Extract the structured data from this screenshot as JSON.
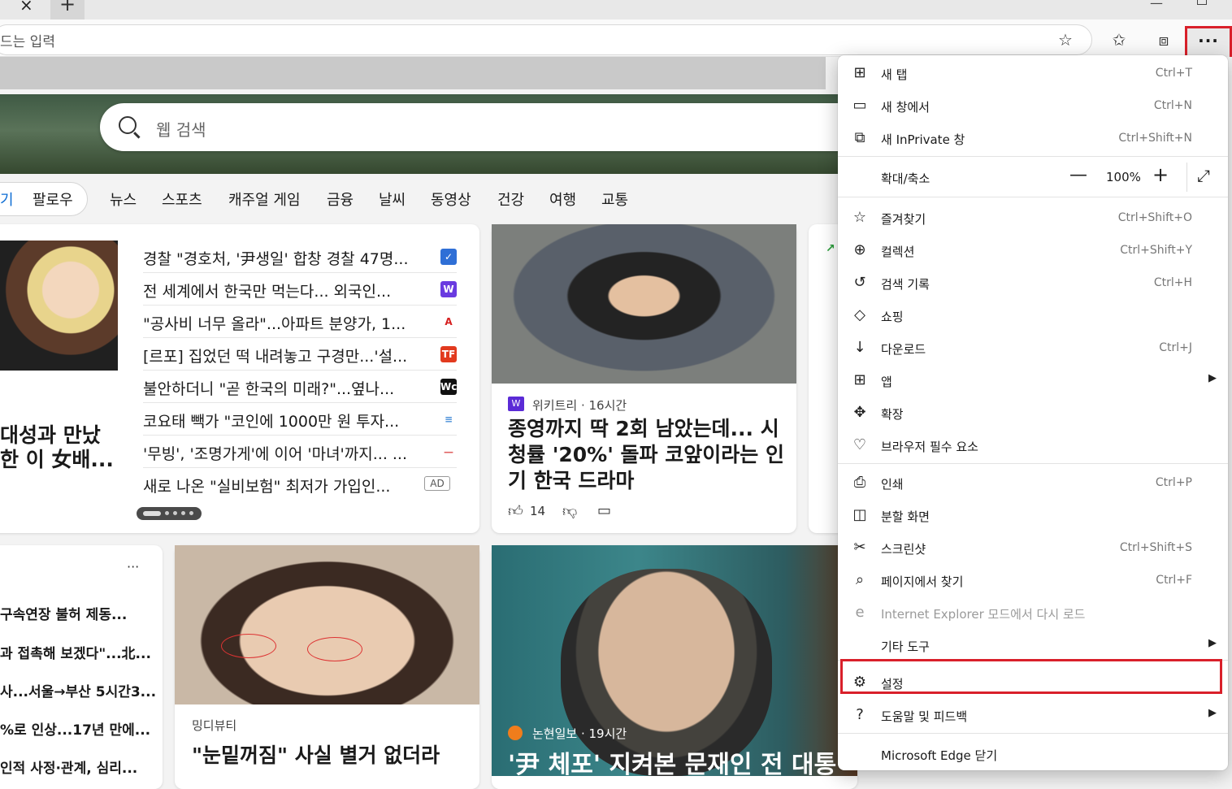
{
  "toolbar": {
    "address_text": "드는 입력",
    "more_label": "···",
    "tab_close": "×",
    "tab_new": "+"
  },
  "page": {
    "search_placeholder": "웹 검색",
    "nav": {
      "first": "기",
      "follow": "팔로우",
      "items": [
        "뉴스",
        "스포츠",
        "캐주얼 게임",
        "금융",
        "날씨",
        "동영상",
        "건강",
        "여행",
        "교통"
      ]
    },
    "card_a": {
      "headline_lines": [
        "대성과 만났",
        "한 이 女배..."
      ],
      "news": [
        {
          "text": "경찰 \"경호처, '尹생일' 합창 경찰 47명...",
          "source_icon": "✓",
          "color": "#2f6fd6"
        },
        {
          "text": "전 세계에서 한국만 먹는다... 외국인...",
          "source_icon": "W",
          "color": "#6a3be0"
        },
        {
          "text": "\"공사비 너무 올라\"...아파트 분양가, 1...",
          "source_icon": "A",
          "color": "#d62020"
        },
        {
          "text": "[르포] 집었던 떡 내려놓고 구경만...'설...",
          "source_icon": "TF",
          "color": "#e23a1e"
        },
        {
          "text": "불안하더니 \"곧 한국의 미래?\"...옆나...",
          "source_icon": "Wc",
          "color": "#111111"
        },
        {
          "text": "코요태 빽가 \"코인에 1000만 원 투자...",
          "source_icon": "≡",
          "color": "#4a8fd8"
        },
        {
          "text": "'무빙', '조명가게'에 이어 '마녀'까지... ...",
          "source_icon": "—",
          "color": "#e06060"
        },
        {
          "text": "새로 나온 \"실비보험\" 최저가 가입인...",
          "source_icon": "",
          "color": "#ffffff"
        }
      ],
      "ad_label": "AD"
    },
    "card_b": {
      "source": "위키트리 · 16시간",
      "title": "종영까지 딱 2회 남았는데... 시청률 '20%' 돌파 코앞이라는 인기 한국 드라마",
      "likes": "14"
    },
    "card_d": {
      "more": "···",
      "items": [
        "구속연장 불허 제동...",
        "과 접촉해 보겠다\"...北...",
        "사...서울→부산 5시간3...",
        "%로 인상...17년 만에...",
        "인적 사정·관계, 심리..."
      ]
    },
    "card_e": {
      "source": "밍디뷰티",
      "title": "\"눈밑꺼짐\" 사실 별거 없더라"
    },
    "card_f": {
      "source": "논현일보 · 19시간",
      "title": "'尹 체포' 지켜본 문재인 전 대통"
    }
  },
  "menu": {
    "items_top": [
      {
        "label": "새 탭",
        "shortcut": "Ctrl+T",
        "icon": "new-tab-icon",
        "glyph": "⊞"
      },
      {
        "label": "새 창에서",
        "shortcut": "Ctrl+N",
        "icon": "new-window-icon",
        "glyph": "▭"
      },
      {
        "label": "새 InPrivate 창",
        "shortcut": "Ctrl+Shift+N",
        "icon": "inprivate-icon",
        "glyph": "⧉"
      }
    ],
    "zoom": {
      "label": "확대/축소",
      "minus": "—",
      "value": "100%",
      "plus": "+",
      "fullscreen": "⤢"
    },
    "items_mid": [
      {
        "label": "즐겨찾기",
        "shortcut": "Ctrl+Shift+O",
        "icon": "favorites-icon",
        "glyph": "☆"
      },
      {
        "label": "컬렉션",
        "shortcut": "Ctrl+Shift+Y",
        "icon": "collections-icon",
        "glyph": "⊕"
      },
      {
        "label": "검색 기록",
        "shortcut": "Ctrl+H",
        "icon": "history-icon",
        "glyph": "↺"
      },
      {
        "label": "쇼핑",
        "shortcut": "",
        "icon": "shopping-tag-icon",
        "glyph": "◇"
      },
      {
        "label": "다운로드",
        "shortcut": "Ctrl+J",
        "icon": "download-icon",
        "glyph": "↓"
      },
      {
        "label": "앱",
        "shortcut": "",
        "icon": "apps-icon",
        "glyph": "⊞",
        "arrow": "▶"
      },
      {
        "label": "확장",
        "shortcut": "",
        "icon": "extensions-icon",
        "glyph": "✥"
      },
      {
        "label": "브라우저 필수 요소",
        "shortcut": "",
        "icon": "heart-pulse-icon",
        "glyph": "♡"
      }
    ],
    "items_tools": [
      {
        "label": "인쇄",
        "shortcut": "Ctrl+P",
        "icon": "print-icon",
        "glyph": "⎙"
      },
      {
        "label": "분할 화면",
        "shortcut": "",
        "icon": "split-screen-icon",
        "glyph": "◫"
      },
      {
        "label": "스크린샷",
        "shortcut": "Ctrl+Shift+S",
        "icon": "screenshot-icon",
        "glyph": "✂"
      },
      {
        "label": "페이지에서 찾기",
        "shortcut": "Ctrl+F",
        "icon": "find-icon",
        "glyph": "⌕"
      },
      {
        "label": "Internet Explorer 모드에서 다시 로드",
        "shortcut": "",
        "icon": "ie-mode-icon",
        "glyph": "e",
        "disabled": true
      },
      {
        "label": "기타 도구",
        "shortcut": "",
        "icon": "",
        "glyph": "",
        "arrow": "▶"
      }
    ],
    "items_bottom": [
      {
        "label": "설정",
        "shortcut": "",
        "icon": "settings-gear-icon",
        "glyph": "⚙"
      },
      {
        "label": "도움말 및 피드백",
        "shortcut": "",
        "icon": "help-icon",
        "glyph": "?",
        "arrow": "▶"
      }
    ],
    "close_label": "Microsoft Edge 닫기"
  },
  "colors": {
    "highlight": "#d9202a",
    "accent": "#0b6bd3"
  }
}
